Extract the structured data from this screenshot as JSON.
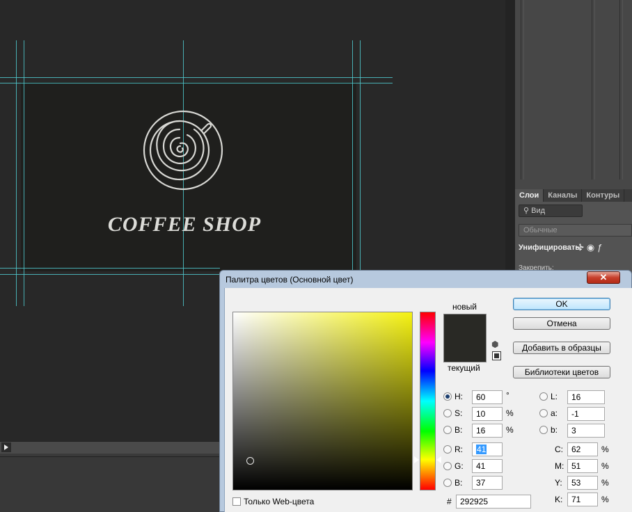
{
  "canvas": {
    "brand_text": "COFFEE SHOP",
    "guide_color": "#4fc8cc"
  },
  "layers_panel": {
    "tabs": [
      {
        "label": "Слои",
        "active": true
      },
      {
        "label": "Каналы",
        "active": false
      },
      {
        "label": "Контуры",
        "active": false
      }
    ],
    "filter_placeholder": "Вид",
    "blend_mode": "Обычные",
    "unify_label": "Унифицировать:",
    "lock_label": "Закрепить:"
  },
  "dialog": {
    "title": "Палитра цветов (Основной цвет)",
    "close_glyph": "✕",
    "label_new": "новый",
    "label_current": "текущий",
    "new_color": "#292925",
    "buttons": {
      "ok": "OK",
      "cancel": "Отмена",
      "add_to_swatches": "Добавить в образцы",
      "color_libraries": "Библиотеки цветов"
    },
    "hsb": {
      "h_label": "H:",
      "h": "60",
      "h_unit": "°",
      "s_label": "S:",
      "s": "10",
      "s_unit": "%",
      "b_label": "B:",
      "b": "16",
      "b_unit": "%"
    },
    "rgb": {
      "r_label": "R:",
      "r": "41",
      "g_label": "G:",
      "g": "41",
      "b_label": "B:",
      "b": "37"
    },
    "lab": {
      "l_label": "L:",
      "l": "16",
      "a_label": "a:",
      "a": "-1",
      "b_label": "b:",
      "b": "3"
    },
    "cmyk": {
      "c_label": "C:",
      "c": "62",
      "m_label": "M:",
      "m": "51",
      "y_label": "Y:",
      "y": "53",
      "k_label": "K:",
      "k": "71",
      "unit": "%"
    },
    "hex_label": "#",
    "hex": "292925",
    "web_only_label": "Только Web-цвета",
    "selected_channel": "H"
  }
}
